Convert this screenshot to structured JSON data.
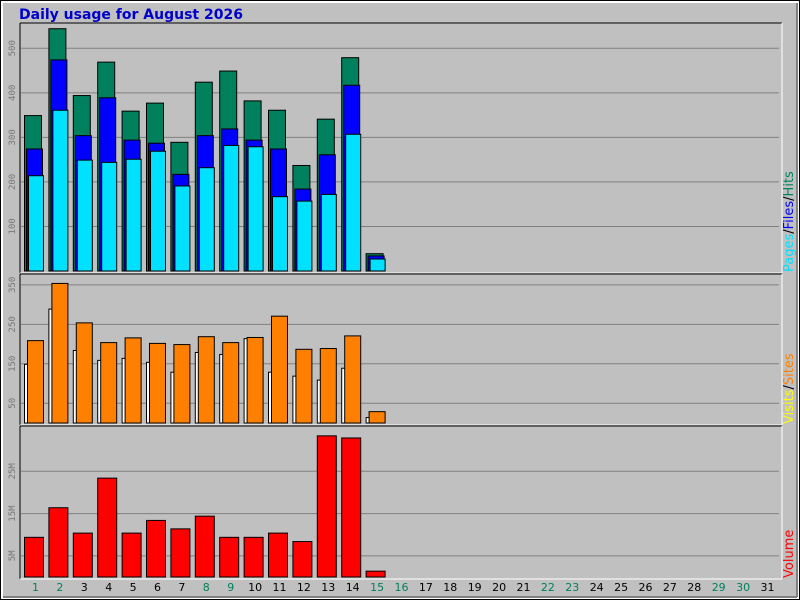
{
  "colors": {
    "background": "#c0c0c0",
    "hits": "#00805c",
    "files": "#0000ff",
    "pages": "#00e0ff",
    "sites": "#ffffff",
    "visits": "#ff8000",
    "volume": "#ff0000",
    "title": "#0000cc",
    "day_weekday": "#000000",
    "day_weekend": "#00805c"
  },
  "chart_data": {
    "type": "bar",
    "title": "Daily usage for August 2026",
    "categories": [
      "1",
      "2",
      "3",
      "4",
      "5",
      "6",
      "7",
      "8",
      "9",
      "10",
      "11",
      "12",
      "13",
      "14",
      "15",
      "16",
      "17",
      "18",
      "19",
      "20",
      "21",
      "22",
      "23",
      "24",
      "25",
      "26",
      "27",
      "28",
      "29",
      "30",
      "31"
    ],
    "weekend_days": [
      "1",
      "2",
      "8",
      "9",
      "15",
      "16",
      "22",
      "23",
      "29",
      "30"
    ],
    "panels": [
      {
        "name": "usage",
        "right_label": "Pages/Files/Hits",
        "right_label_parts": [
          {
            "text": "Pages",
            "color": "#00e0ff"
          },
          {
            "text": "/",
            "color": "#000000"
          },
          {
            "text": "Files",
            "color": "#0000ff"
          },
          {
            "text": "/",
            "color": "#000000"
          },
          {
            "text": "Hits",
            "color": "#00805c"
          }
        ],
        "ylim": [
          0,
          550
        ],
        "ticks": [
          100,
          200,
          300,
          400,
          500
        ],
        "tick_labels": [
          "100",
          "200",
          "300",
          "400",
          "500"
        ],
        "grid": true,
        "series": [
          {
            "name": "Hits",
            "color": "#00805c",
            "values": [
              350,
              545,
              395,
              470,
              360,
              378,
              290,
              425,
              450,
              383,
              362,
              238,
              342,
              480,
              40,
              0,
              0,
              0,
              0,
              0,
              0,
              0,
              0,
              0,
              0,
              0,
              0,
              0,
              0,
              0,
              0
            ]
          },
          {
            "name": "Files",
            "color": "#0000ff",
            "values": [
              275,
              475,
              305,
              390,
              295,
              288,
              218,
              305,
              320,
              295,
              275,
              185,
              262,
              418,
              35,
              0,
              0,
              0,
              0,
              0,
              0,
              0,
              0,
              0,
              0,
              0,
              0,
              0,
              0,
              0,
              0
            ]
          },
          {
            "name": "Pages",
            "color": "#00e0ff",
            "values": [
              215,
              362,
              250,
              245,
              252,
              270,
              192,
              233,
              283,
              280,
              168,
              158,
              173,
              308,
              28,
              0,
              0,
              0,
              0,
              0,
              0,
              0,
              0,
              0,
              0,
              0,
              0,
              0,
              0,
              0,
              0
            ]
          }
        ]
      },
      {
        "name": "visits",
        "right_label": "Visits/Sites",
        "right_label_parts": [
          {
            "text": "Visits",
            "color": "#ffff00"
          },
          {
            "text": "/",
            "color": "#000000"
          },
          {
            "text": "Sites",
            "color": "#ff8000"
          }
        ],
        "ylim": [
          0,
          370
        ],
        "ticks": [
          50,
          150,
          250,
          350
        ],
        "tick_labels": [
          "50",
          "150",
          "250",
          "350"
        ],
        "grid": true,
        "series": [
          {
            "name": "Sites",
            "color": "#ffffff",
            "values": [
              150,
              290,
              185,
              160,
              165,
              155,
              130,
              180,
              175,
              215,
              130,
              120,
              110,
              140,
              15,
              0,
              0,
              0,
              0,
              0,
              0,
              0,
              0,
              0,
              0,
              0,
              0,
              0,
              0,
              0,
              0
            ]
          },
          {
            "name": "Visits",
            "color": "#ff8000",
            "values": [
              210,
              355,
              255,
              205,
              217,
              203,
              200,
              220,
              205,
              218,
              272,
              188,
              190,
              222,
              30,
              0,
              0,
              0,
              0,
              0,
              0,
              0,
              0,
              0,
              0,
              0,
              0,
              0,
              0,
              0,
              0
            ]
          }
        ]
      },
      {
        "name": "volume",
        "right_label": "Volume",
        "right_label_parts": [
          {
            "text": "Volume",
            "color": "#ff0000"
          }
        ],
        "ylim": [
          0,
          35
        ],
        "unit": "M",
        "ticks": [
          5,
          15,
          25
        ],
        "tick_labels": [
          "5M",
          "15M",
          "25M"
        ],
        "grid": true,
        "series": [
          {
            "name": "Volume",
            "color": "#ff0000",
            "values": [
              9.5,
              16.5,
              10.5,
              23.5,
              10.5,
              13.5,
              11.5,
              14.5,
              9.5,
              9.5,
              10.5,
              8.5,
              33.5,
              33,
              1.5,
              0,
              0,
              0,
              0,
              0,
              0,
              0,
              0,
              0,
              0,
              0,
              0,
              0,
              0,
              0,
              0
            ]
          }
        ]
      }
    ]
  }
}
